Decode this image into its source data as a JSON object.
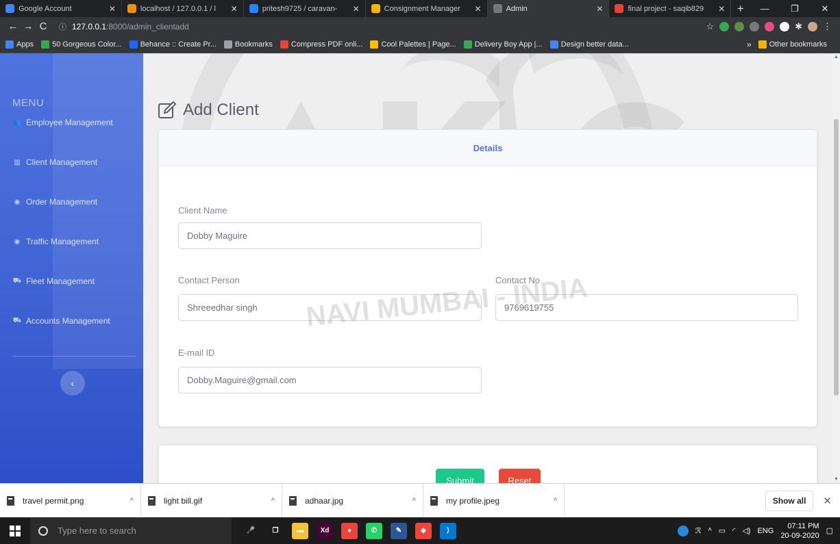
{
  "browser": {
    "tabs": [
      {
        "title": "Google Account",
        "favicon": "google-icon",
        "color": "#4285f4",
        "active": false
      },
      {
        "title": "localhost / 127.0.0.1 / l",
        "favicon": "phpmyadmin-icon",
        "color": "#f29111",
        "active": false
      },
      {
        "title": "pritesh9725 / caravan-",
        "favicon": "bitbucket-icon",
        "color": "#2684ff",
        "active": false
      },
      {
        "title": "Consignment Manager",
        "favicon": "document-icon",
        "color": "#f4b400",
        "active": false
      },
      {
        "title": "Admin",
        "favicon": "globe-icon",
        "color": "#777777",
        "active": true
      },
      {
        "title": "final project - saqib829",
        "favicon": "gmail-icon",
        "color": "#ea4335",
        "active": false
      }
    ],
    "url_host": "127.0.0.1",
    "url_path": ":8000/admin_clientadd",
    "bookmarks": [
      {
        "label": "Apps",
        "icon": "apps-grid-icon",
        "color": "#4285f4"
      },
      {
        "label": "50 Gorgeous Color...",
        "icon": "palette-icon",
        "color": "#34a853"
      },
      {
        "label": "Behance :: Create Pr...",
        "icon": "behance-icon",
        "color": "#1769ff"
      },
      {
        "label": "Bookmarks",
        "icon": "star-icon",
        "color": "#9aa0a6"
      },
      {
        "label": "Compress PDF onli...",
        "icon": "heart-icon",
        "color": "#ea4335"
      },
      {
        "label": "Cool Palettes | Page...",
        "icon": "palette-icon",
        "color": "#fbbc05"
      },
      {
        "label": "Delivery Boy App |...",
        "icon": "dribbble-icon",
        "color": "#34a853"
      },
      {
        "label": "Design better data...",
        "icon": "info-icon",
        "color": "#4285f4"
      }
    ],
    "other_bookmarks": "Other bookmarks",
    "overflow": "»"
  },
  "sidebar": {
    "heading": "MENU",
    "items": [
      {
        "label": "Employee Management",
        "icon": "users-icon"
      },
      {
        "label": "Client Management",
        "icon": "building-icon"
      },
      {
        "label": "Order Management",
        "icon": "eye-icon"
      },
      {
        "label": "Traffic Management",
        "icon": "eye-icon"
      },
      {
        "label": "Fleet Management",
        "icon": "truck-icon"
      },
      {
        "label": "Accounts Management",
        "icon": "truck-icon"
      }
    ],
    "toggle_label": "‹"
  },
  "page": {
    "title": "Add Client",
    "card_header": "Details",
    "fields": {
      "client_name_label": "Client Name",
      "client_name_value": "Dobby Maguire",
      "contact_person_label": "Contact Person",
      "contact_person_value": "Shreeedhar singh",
      "contact_no_label": "Contact No",
      "contact_no_value": "9769619755",
      "email_label": "E-mail ID",
      "email_value": "Dobby.Maguire@gmail.com"
    },
    "submit_label": "Submit",
    "reset_label": "Reset",
    "watermark": {
      "logo": "AKTC",
      "text": "NAVI MUMBAI - INDIA"
    }
  },
  "downloads": {
    "items": [
      "travel permit.png",
      "light bill.gif",
      "adhaar.jpg",
      "my profile.jpeg"
    ],
    "show_all": "Show all"
  },
  "taskbar": {
    "search_placeholder": "Type here to search",
    "language": "ENG",
    "time": "07:11 PM",
    "date": "20-09-2020",
    "apps": [
      {
        "name": "microphone-icon",
        "color": "#1c1c1c",
        "glyph": "🎤"
      },
      {
        "name": "task-view-icon",
        "color": "#1c1c1c",
        "glyph": "❐"
      },
      {
        "name": "file-explorer-icon",
        "color": "#f3c13a",
        "glyph": "▬"
      },
      {
        "name": "adobe-xd-icon",
        "color": "#470137",
        "glyph": "Xd"
      },
      {
        "name": "chrome-icon",
        "color": "#e8453c",
        "glyph": "●"
      },
      {
        "name": "whatsapp-icon",
        "color": "#25d366",
        "glyph": "✆"
      },
      {
        "name": "pen-icon",
        "color": "#2b5797",
        "glyph": "✎"
      },
      {
        "name": "anydesk-icon",
        "color": "#ef443b",
        "glyph": "◆"
      },
      {
        "name": "vscode-icon",
        "color": "#0078d4",
        "glyph": "⟩"
      }
    ]
  }
}
